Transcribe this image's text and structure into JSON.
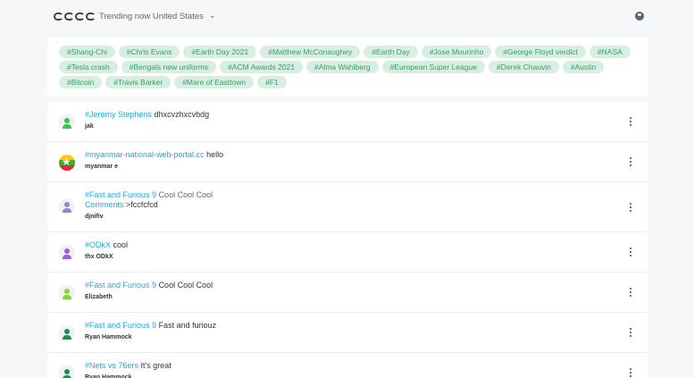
{
  "header": {
    "title": "Trending now United States",
    "logo_icon": "cccc-logo-icon",
    "dropdown_icon": "chevron-down-icon",
    "account_icon": "user-circle-icon"
  },
  "tags": [
    "#Shang-Chi",
    "#Chris Evans",
    "#Earth Day 2021",
    "#Matthew McConaughey",
    "#Earth Day",
    "#Jose Mourinho",
    "#George Floyd verdict",
    "#NASA",
    "#Tesla crash",
    "#Bengals new uniforms",
    "#ACM Awards 2021",
    "#Alma Wahlberg",
    "#European Super League",
    "#Derek Chauvin",
    "#Austin",
    "#Bitcoin",
    "#Travis Barker",
    "#Mare of Easttown",
    "#F1"
  ],
  "posts": [
    {
      "hashtag": "#Jeremy Stephens",
      "text": "dhxcvzhxcvbdg",
      "author": "jak",
      "avatar": "user-icon",
      "avatar_color": "#2ecc40"
    },
    {
      "hashtag": "#myanmar-national-web-portal.cc",
      "text": "hello",
      "author": "myanmar e",
      "avatar": "myanmar-flag-icon"
    },
    {
      "hashtag": "#Fast and Furious 9",
      "text": "Cool Cool Cool",
      "comments_label": "Comments:",
      "comments_text": ">fccfcfcd",
      "author": "djnifiv",
      "avatar": "user-icon",
      "avatar_color": "#8e86d6"
    },
    {
      "hashtag": "#ODkX",
      "text": "cool",
      "author": "thx ODkX",
      "avatar": "user-icon",
      "avatar_color": "#9b5de5"
    },
    {
      "hashtag": "#Fast and Furious 9",
      "text": "Cool Cool Cool",
      "author": "Elizabeth",
      "avatar": "user-icon",
      "avatar_color": "#8bd23a"
    },
    {
      "hashtag": "#Fast and Furious 9",
      "text": "Fast and furiouz",
      "author": "Ryan Hammock",
      "avatar": "user-icon",
      "avatar_color": "#1e8e4a"
    },
    {
      "hashtag": "#Nets vs 76ers",
      "text": "It's great",
      "author": "Ryan Hammock",
      "avatar": "user-icon",
      "avatar_color": "#1e8e4a"
    }
  ],
  "colors": {
    "tag_bg": "#d7efe2",
    "tag_text": "#3c9a6c",
    "hashtag": "#22a9d6"
  }
}
